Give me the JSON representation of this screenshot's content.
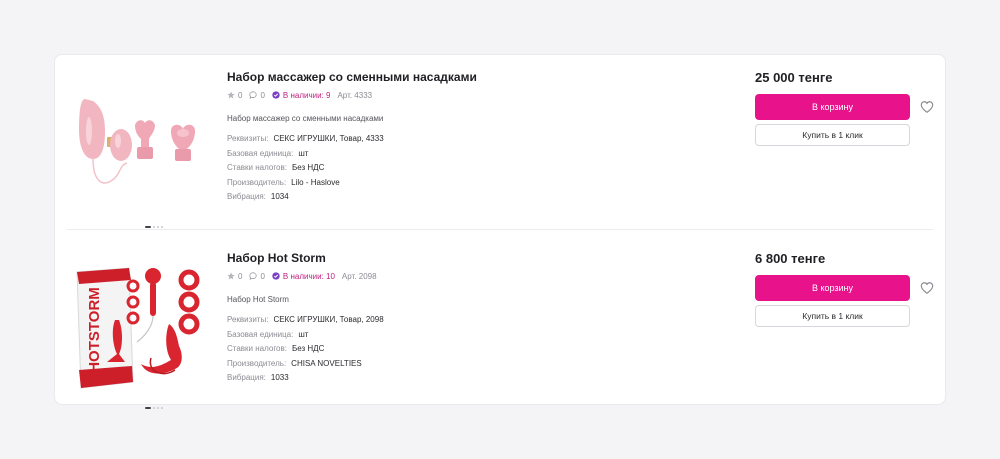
{
  "products": [
    {
      "title": "Набор массажер со сменными насадками",
      "rating": "0",
      "comments": "0",
      "stock": "В наличии: 9",
      "article": "Арт. 4333",
      "description": "Набор массажер со сменными насадками",
      "props": [
        {
          "k": "Реквизиты:",
          "v": "СЕКС ИГРУШКИ, Товар, 4333"
        },
        {
          "k": "Базовая единица:",
          "v": "шт"
        },
        {
          "k": "Ставки налогов:",
          "v": "Без НДС"
        },
        {
          "k": "Производитель:",
          "v": "Lilo - Haslove"
        },
        {
          "k": "Вибрация:",
          "v": "1034"
        }
      ],
      "price": "25 000 тенге",
      "cart_label": "В корзину",
      "one_click_label": "Купить в 1 клик",
      "image_icon": "pink-massager-set-image"
    },
    {
      "title": "Набор Hot Storm",
      "rating": "0",
      "comments": "0",
      "stock": "В наличии: 10",
      "article": "Арт. 2098",
      "description": "Набор Hot Storm",
      "props": [
        {
          "k": "Реквизиты:",
          "v": "СЕКС ИГРУШКИ, Товар, 2098"
        },
        {
          "k": "Базовая единица:",
          "v": "шт"
        },
        {
          "k": "Ставки налогов:",
          "v": "Без НДС"
        },
        {
          "k": "Производитель:",
          "v": "CHISA NOVELTIES"
        },
        {
          "k": "Вибрация:",
          "v": "1033"
        }
      ],
      "price": "6 800 тенге",
      "cart_label": "В корзину",
      "one_click_label": "Купить в 1 клик",
      "image_icon": "red-hot-storm-kit-image",
      "box_brand_text": "HOTSTORM"
    }
  ],
  "colors": {
    "accent": "#e8138a",
    "stock": "#c0207f",
    "stock_check": "#7b3fc6"
  }
}
